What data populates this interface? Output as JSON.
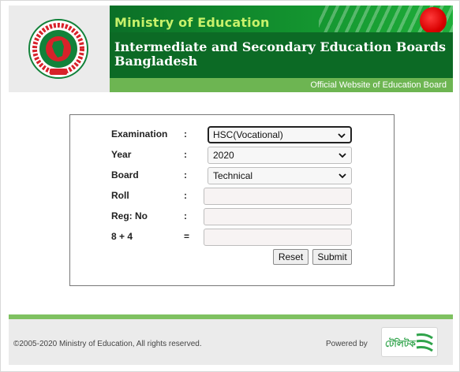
{
  "header": {
    "ministry": "Ministry of Education",
    "boards_title": "Intermediate and Secondary Education Boards Bangladesh",
    "official_site": "Official Website of Education Board"
  },
  "form": {
    "fields": [
      {
        "label": "Examination",
        "sep": ":",
        "type": "select",
        "value": "HSC(Vocational)",
        "focused": true
      },
      {
        "label": "Year",
        "sep": ":",
        "type": "select",
        "value": "2020"
      },
      {
        "label": "Board",
        "sep": ":",
        "type": "select",
        "value": "Technical"
      },
      {
        "label": "Roll",
        "sep": ":",
        "type": "input",
        "value": ""
      },
      {
        "label": "Reg: No",
        "sep": ":",
        "type": "input",
        "value": ""
      },
      {
        "label": "8 + 4",
        "sep": "=",
        "type": "input",
        "value": ""
      }
    ],
    "reset_label": "Reset",
    "submit_label": "Submit"
  },
  "footer": {
    "copyright": "©2005-2020 Ministry of Education, All rights reserved.",
    "powered_by": "Powered by",
    "teletalk_logo": "টেলিটক"
  },
  "colors": {
    "banner_green": "#0c6a25",
    "ministry_text": "#c7f16a",
    "official_bar": "#6db552",
    "footer_stripe": "#7fc161",
    "emblem_red": "#d8222a",
    "emblem_green": "#12823a"
  },
  "icons": [
    "govt-emblem-icon",
    "chevron-down-icon",
    "teletalk-logo-icon"
  ]
}
